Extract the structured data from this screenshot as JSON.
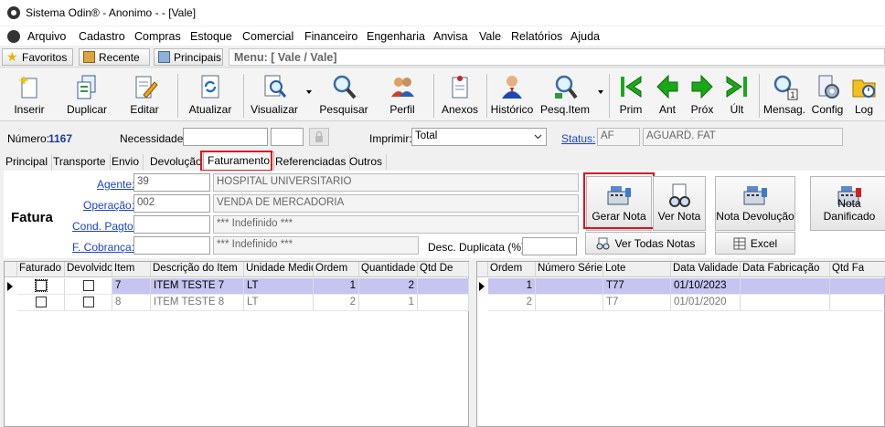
{
  "window": {
    "title": "Sistema Odin® - Anonimo -  - [Vale]"
  },
  "menu": [
    "Arquivo",
    "Cadastro",
    "Compras",
    "Estoque",
    "Comercial",
    "Financeiro",
    "Engenharia",
    "Anvisa",
    "Vale",
    "Relatórios",
    "Ajuda"
  ],
  "favbar": {
    "favoritos": "Favoritos",
    "recente": "Recente",
    "principais": "Principais",
    "menu_path": "Menu: [ Vale / Vale]"
  },
  "toolbar": {
    "inserir": "Inserir",
    "duplicar": "Duplicar",
    "editar": "Editar",
    "atualizar": "Atualizar",
    "visualizar": "Visualizar",
    "pesquisar": "Pesquisar",
    "perfil": "Perfil",
    "anexos": "Anexos",
    "historico": "Histórico",
    "pesq_item": "Pesq.Item",
    "prim": "Prim",
    "ant": "Ant",
    "prox": "Próx",
    "ult": "Últ",
    "mensag": "Mensag.",
    "mensag_badge": "1",
    "config": "Config",
    "log": "Log"
  },
  "header": {
    "numero_label": "Número:",
    "numero_value": "1167",
    "necessidade_label": "Necessidade:",
    "imprimir_label": "Imprimir:",
    "imprimir_value": "Total",
    "status_label": "Status:",
    "status_code": "AF",
    "status_desc": "AGUARD. FAT"
  },
  "tabs": [
    "Principal",
    "Transporte",
    "Envio",
    "Devolução",
    "Faturamento",
    "Referenciadas",
    "Outros"
  ],
  "fatura": {
    "title": "Fatura",
    "agente_label": "Agente:",
    "agente_code": "39",
    "agente_name": "HOSPITAL UNIVERSITARIO",
    "operacao_label": "Operação:",
    "operacao_code": "002",
    "operacao_name": "VENDA DE MERCADORIA",
    "cond_label": "Cond. Pagto:",
    "cond_value": "*** Indefinido ***",
    "cobranca_label": "F. Cobrança:",
    "cobranca_value": "*** Indefinido ***",
    "desc_label": "Desc. Duplicata (%):"
  },
  "actions": {
    "gerar_nota": "Gerar Nota",
    "ver_nota": "Ver Nota",
    "nota_devolucao": "Nota Devolução",
    "nota_danificado": "Nota Danificado",
    "ver_todas": "Ver Todas Notas",
    "excel": "Excel"
  },
  "items_grid": {
    "headers": [
      "Faturado",
      "Devolvido",
      "Item",
      "Descrição do Item",
      "Unidade Medida",
      "Ordem",
      "Quantidade",
      "Qtd De"
    ],
    "rows": [
      {
        "item": "7",
        "descricao": "ITEM TESTE 7",
        "unidade": "LT",
        "ordem": "1",
        "quantidade": "2"
      },
      {
        "item": "8",
        "descricao": "ITEM TESTE 8",
        "unidade": "LT",
        "ordem": "2",
        "quantidade": "1"
      }
    ]
  },
  "lots_grid": {
    "headers": [
      "Ordem",
      "Número Série",
      "Lote",
      "Data Validade",
      "Data Fabricação",
      "Qtd Fa"
    ],
    "rows": [
      {
        "ordem": "1",
        "serie": "",
        "lote": "T77",
        "validade": "01/10/2023",
        "fabricacao": ""
      },
      {
        "ordem": "2",
        "serie": "",
        "lote": "T7",
        "validade": "01/01/2020",
        "fabricacao": ""
      }
    ]
  },
  "colors": {
    "link": "#1a44c8",
    "highlight": "#e0101c",
    "selected_row": "#c6c4f0"
  }
}
